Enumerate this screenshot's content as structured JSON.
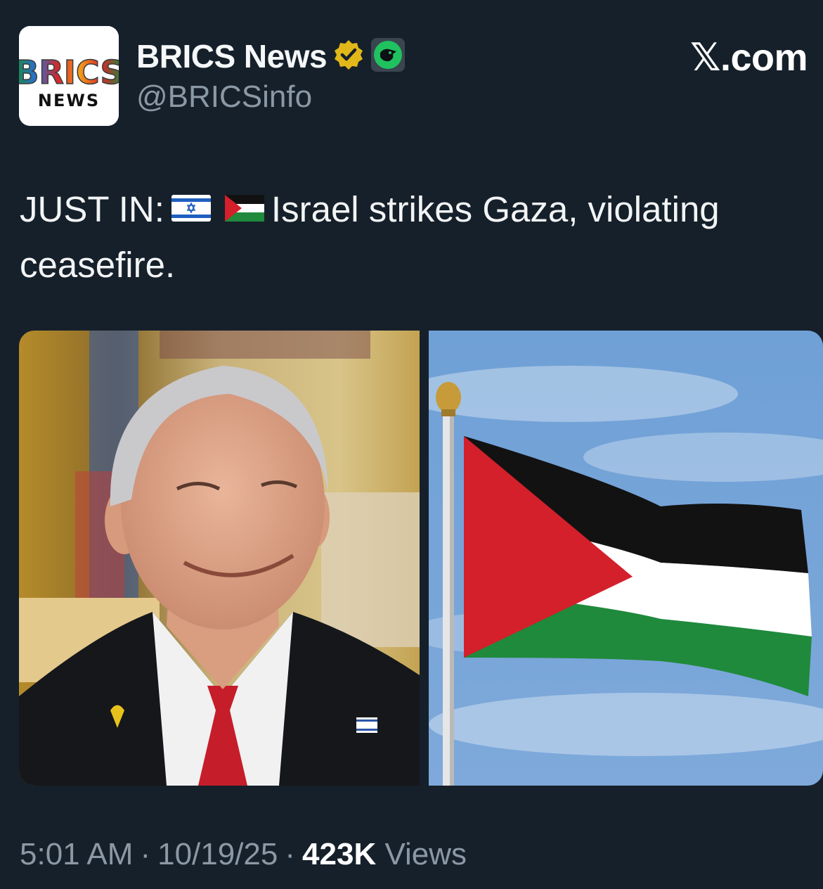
{
  "account": {
    "avatar_text_top": "BRICS",
    "avatar_text_bottom": "NEWS",
    "display_name": "BRICS News",
    "handle": "@BRICSinfo",
    "verified_color": "#e2b719",
    "affiliate_badge_color": "#1fc25f"
  },
  "source": {
    "site_glyph": "𝕏",
    "site_suffix": ".com"
  },
  "tweet": {
    "prefix": "JUST IN:",
    "text_line1": "Israel strikes Gaza, violating",
    "text_line2": "ceasefire."
  },
  "meta": {
    "time": "5:01 AM",
    "separator": "·",
    "date": "10/19/25",
    "views_count": "423K",
    "views_label": "Views"
  }
}
